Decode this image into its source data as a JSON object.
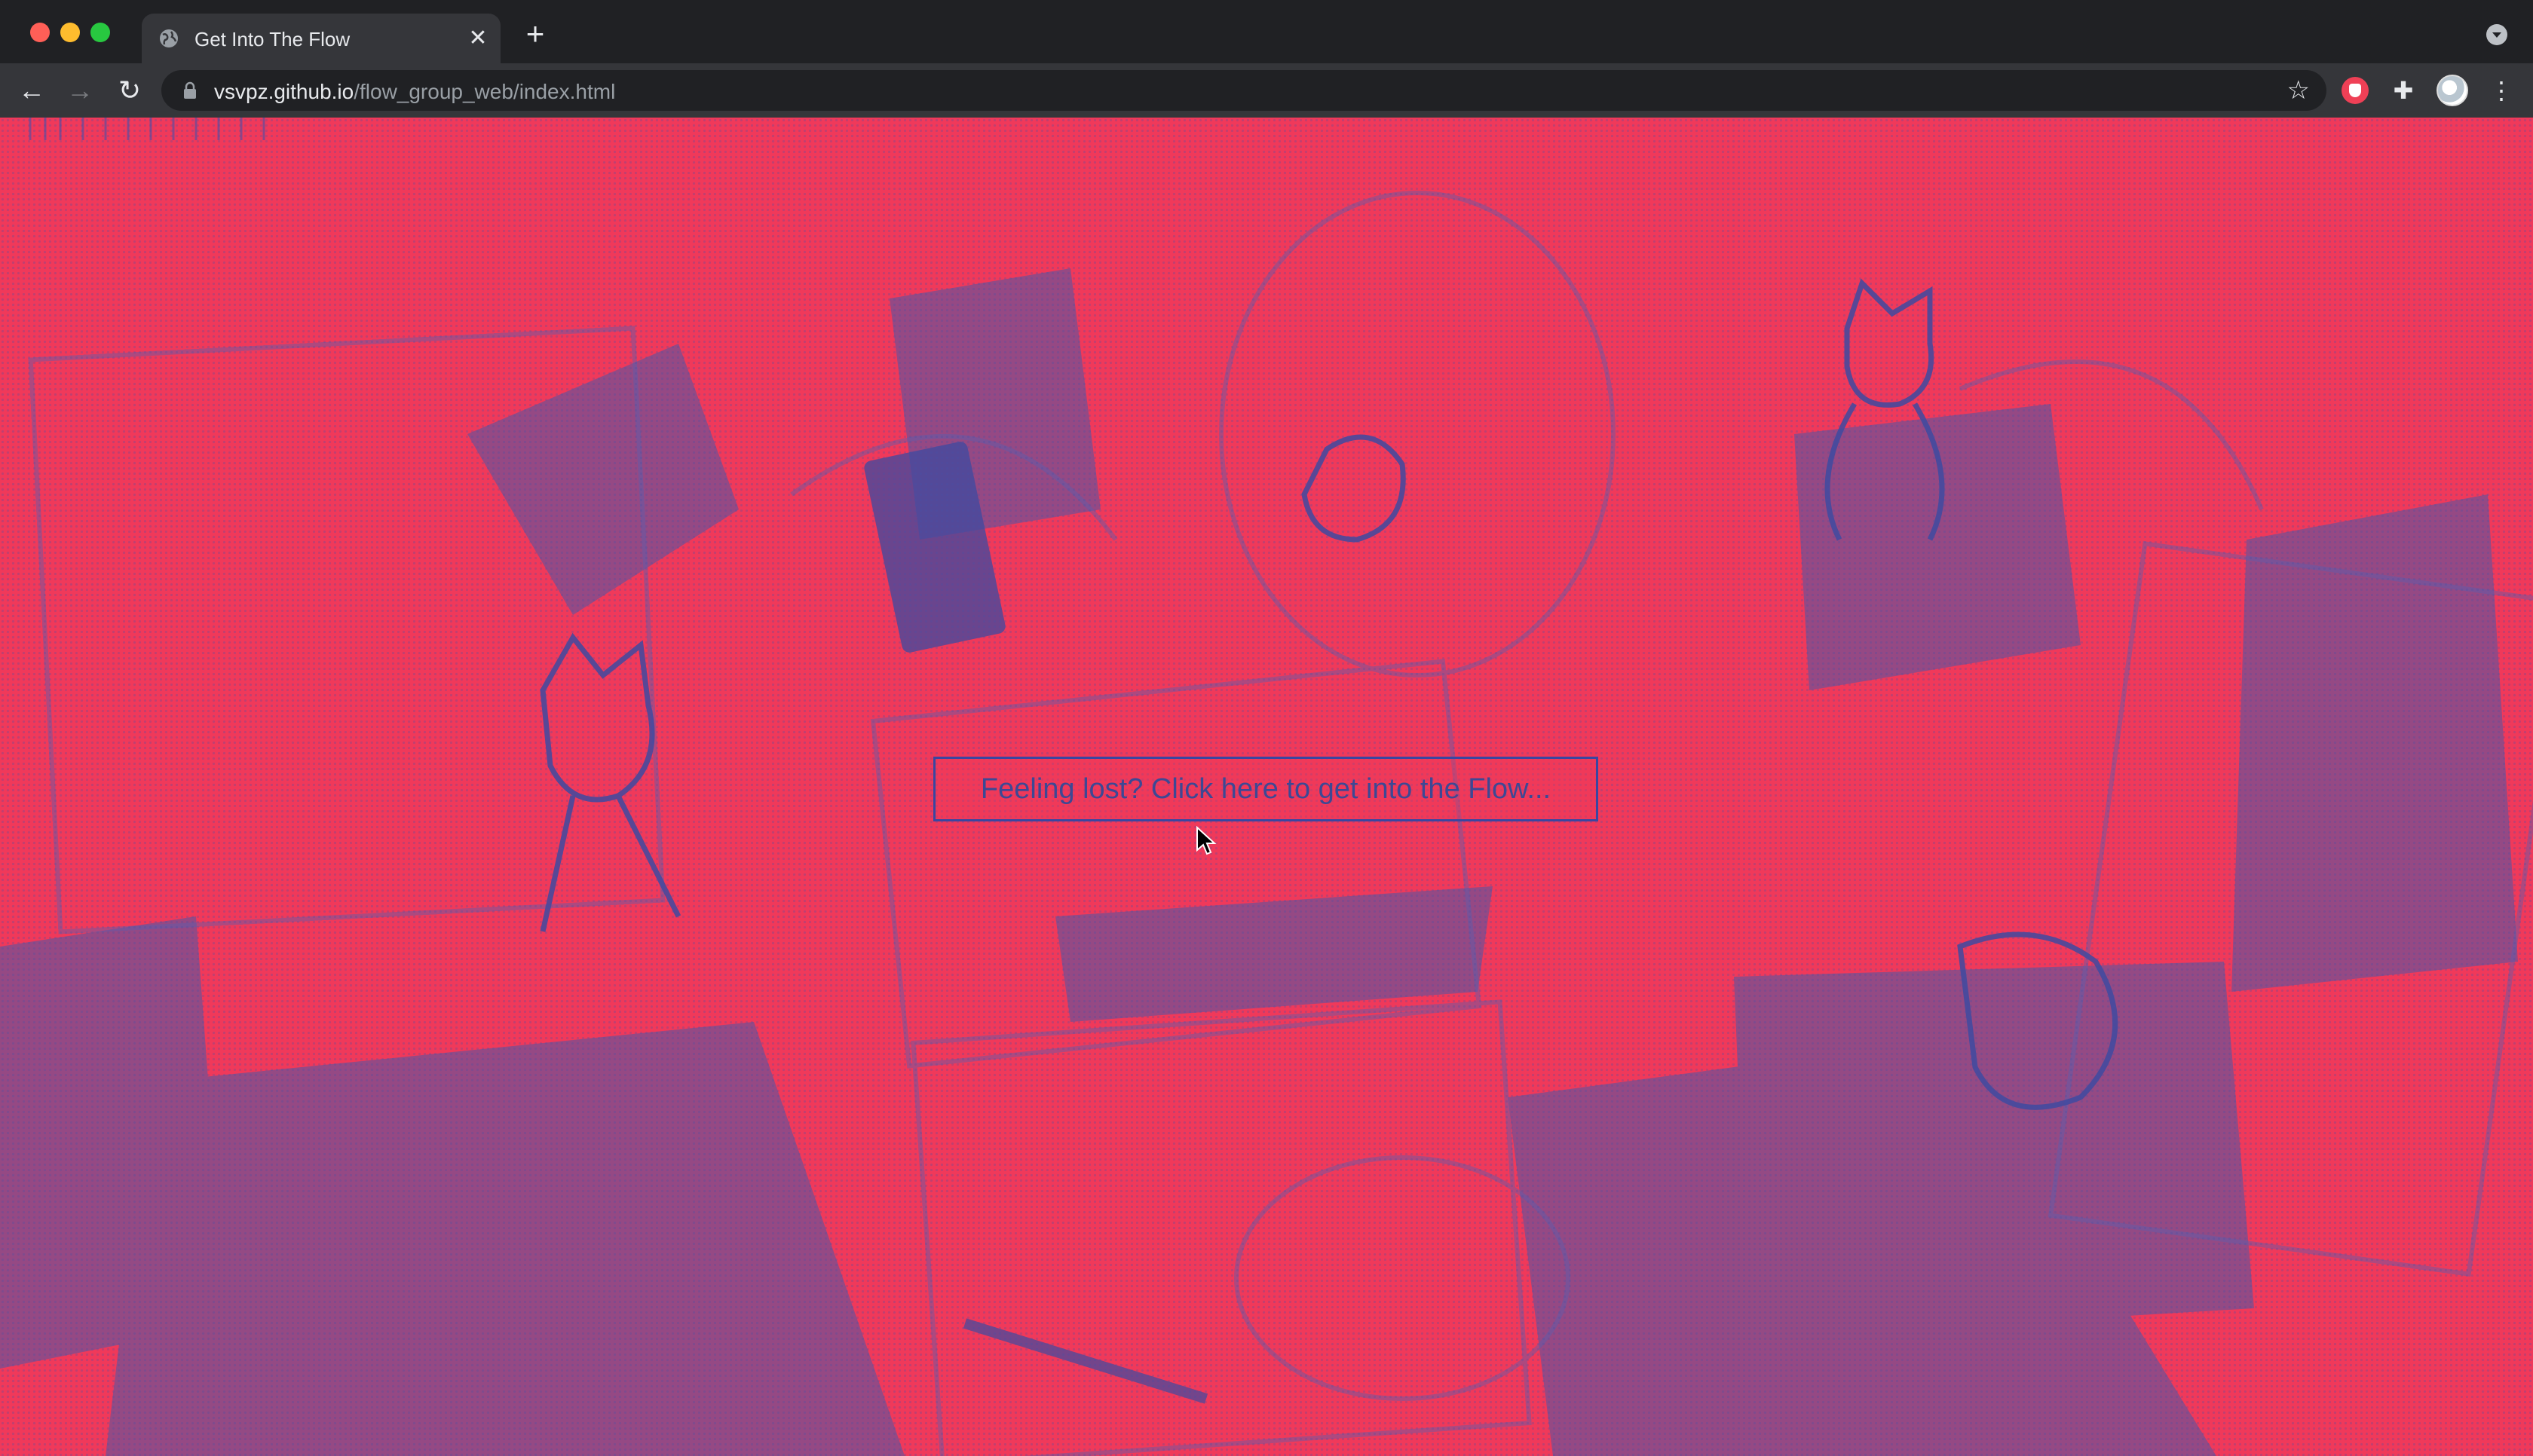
{
  "browser": {
    "tab": {
      "title": "Get Into The Flow",
      "favicon": "globe-icon",
      "close_glyph": "✕"
    },
    "new_tab_glyph": "+",
    "nav": {
      "back_glyph": "←",
      "forward_glyph": "→",
      "reload_glyph": "↻"
    },
    "address_bar": {
      "host": "vsvpz.github.io",
      "path": "/flow_group_web/index.html"
    },
    "bookmark_glyph": "☆",
    "extensions_glyph": "✚",
    "menu_glyph": "⋮"
  },
  "page": {
    "cta_label": "Feeling lost? Click here to get into the Flow...",
    "colors": {
      "background": "#f0395a",
      "halftone": "#4c5aa6",
      "cta_border": "#3a46a0"
    }
  }
}
